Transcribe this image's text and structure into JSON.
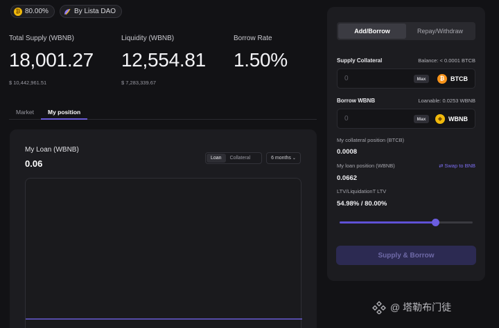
{
  "pills": {
    "ltv_badge": "80.00%",
    "provider_badge": "By Lista DAO"
  },
  "stats": [
    {
      "label": "Total Supply (WBNB)",
      "value": "18,001.27",
      "usd": "$ 10,442,961.51"
    },
    {
      "label": "Liquidity (WBNB)",
      "value": "12,554.81",
      "usd": "$ 7,283,339.67"
    },
    {
      "label": "Borrow Rate",
      "value": "1.50%",
      "usd": ""
    }
  ],
  "tabs": [
    {
      "label": "Market",
      "active": false
    },
    {
      "label": "My position",
      "active": true
    }
  ],
  "loan_card": {
    "title": "My Loan (WBNB)",
    "value": "0.06",
    "toggle": [
      {
        "label": "Loan",
        "active": true
      },
      {
        "label": "Collateral",
        "active": false
      }
    ],
    "period": "6 months"
  },
  "panel": {
    "modes": [
      {
        "label": "Add/Borrow",
        "active": true
      },
      {
        "label": "Repay/Withdraw",
        "active": false
      }
    ],
    "supply": {
      "label": "Supply Collateral",
      "meta": "Balance: < 0.0001 BTCB",
      "placeholder": "0",
      "max_label": "Max",
      "token": "BTCB"
    },
    "borrow": {
      "label": "Borrow WBNB",
      "meta": "Loanable: 0.0253 WBNB",
      "placeholder": "0",
      "max_label": "Max",
      "token": "WBNB"
    },
    "collateral_position": {
      "label": "My collateral position (BTCB)",
      "value": "0.0008"
    },
    "loan_position": {
      "label": "My loan position (WBNB)",
      "value": "0.0662",
      "swap_label": "Swap to BNB"
    },
    "ltv": {
      "label": "LTV/LiquidationT LTV",
      "value": "54.98% / 80.00%",
      "slider_fraction": 0.72
    },
    "submit_label": "Supply & Borrow"
  },
  "watermark": "@ 塔勒布门徒",
  "colors": {
    "accent": "#6a5cd8",
    "bnb": "#f0b90b",
    "btc": "#f7931a",
    "background": "#121215"
  }
}
